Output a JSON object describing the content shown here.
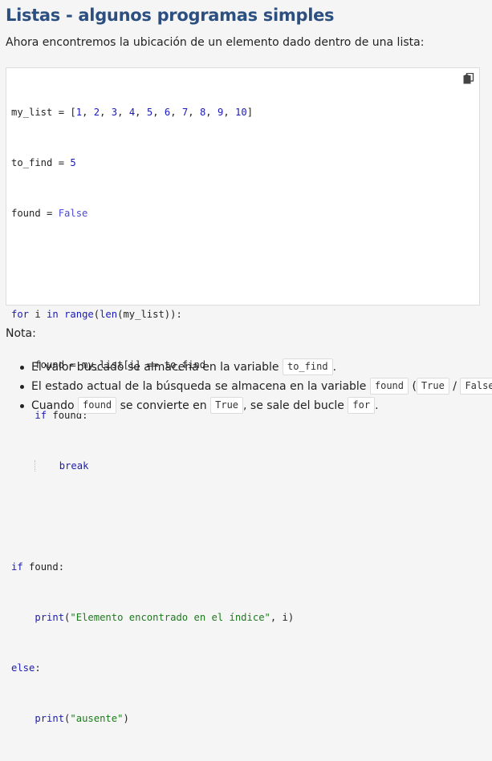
{
  "page": {
    "title": "Listas - algunos programas simples",
    "intro": "Ahora encontremos la ubicación de un elemento dado dentro de una lista:"
  },
  "code_block": {
    "copy_icon": "copy-icon",
    "lines": [
      "my_list = [1, 2, 3, 4, 5, 6, 7, 8, 9, 10]",
      "to_find = 5",
      "found = False",
      "",
      "for i in range(len(my_list)):",
      "    found = my_list[i] == to_find",
      "    if found:",
      "        break",
      "",
      "if found:",
      "    print(\"Elemento encontrado en el índice\", i)",
      "else:",
      "    print(\"ausente\")"
    ]
  },
  "note": {
    "label": "Nota:",
    "items": [
      {
        "before": "El valor buscado se almacena en la variable ",
        "code1": "to_find",
        "after": "."
      },
      {
        "before": "El estado actual de la búsqueda se almacena en la variable ",
        "code1": "found",
        "between1": " (",
        "code2": "True",
        "between2": " / ",
        "code3": "False",
        "after": ")."
      },
      {
        "before": "Cuando ",
        "code1": "found",
        "between1": " se convierte en ",
        "code2": "True",
        "between2": ", se sale del bucle ",
        "code3": "for",
        "after": "."
      }
    ]
  },
  "colors": {
    "title": "#2c4f7f",
    "keyword": "#1a1ab5",
    "string": "#1d7a1d",
    "background": "#f5f5f5",
    "code_background": "#ffffff"
  }
}
